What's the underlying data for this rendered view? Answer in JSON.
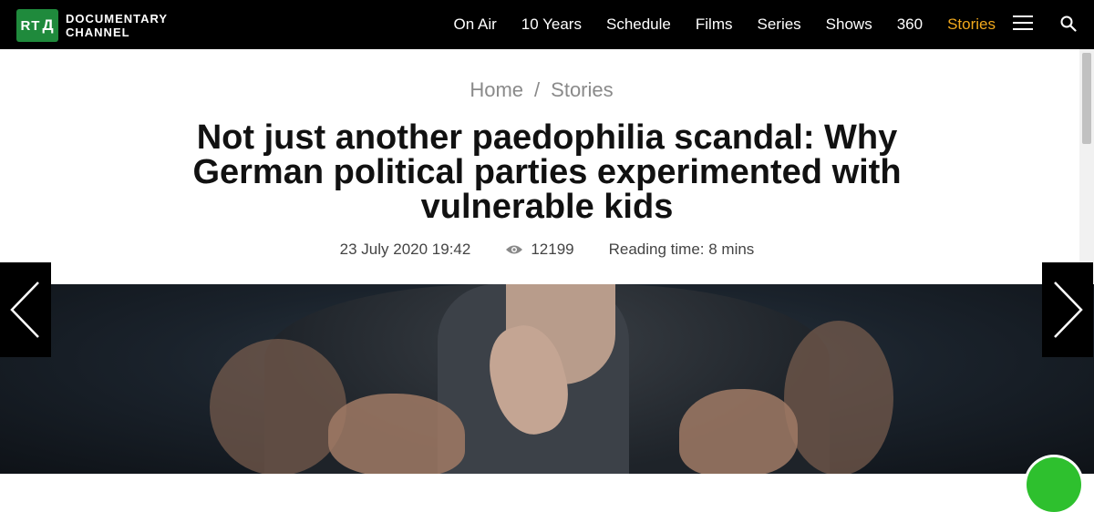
{
  "header": {
    "logo_badge_left": "RT",
    "logo_badge_right": "Д",
    "logo_line1": "DOCUMENTARY",
    "logo_line2": "CHANNEL",
    "nav": [
      {
        "label": "On Air"
      },
      {
        "label": "10 Years"
      },
      {
        "label": "Schedule"
      },
      {
        "label": "Films"
      },
      {
        "label": "Series"
      },
      {
        "label": "Shows"
      },
      {
        "label": "360"
      },
      {
        "label": "Stories",
        "active": true
      }
    ],
    "active_color": "#f0a81c"
  },
  "breadcrumb": {
    "home": "Home",
    "separator": "/",
    "current": "Stories"
  },
  "article": {
    "title": "Not just another paedophilia scandal: Why German political parties experimented with vulnerable kids",
    "date": "23 July 2020 19:42",
    "views": "12199",
    "reading_time": "Reading time: 8 mins"
  },
  "icons": {
    "menu": "hamburger-menu-icon",
    "search": "search-icon",
    "views": "eye-icon",
    "prev": "chevron-left-icon",
    "next": "chevron-right-icon"
  },
  "colors": {
    "logo_green": "#1f8a3c",
    "chat_button_green": "#2ec02e"
  }
}
